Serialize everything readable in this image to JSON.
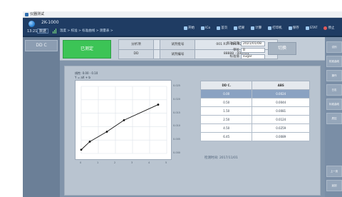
{
  "window": {
    "title": "仪器测试"
  },
  "header": {
    "model": "2K-1000",
    "time": "13:21",
    "mode": "数据",
    "breadcrumb": "温度 > 校准 > 标准曲线 > 测量表 >"
  },
  "toolbar": [
    {
      "label": "开始",
      "icon": "play-icon"
    },
    {
      "label": "ICo",
      "icon": "control-icon"
    },
    {
      "label": "首页",
      "icon": "home-icon"
    },
    {
      "label": "结果",
      "icon": "result-icon"
    },
    {
      "label": "计算",
      "icon": "calc-icon"
    },
    {
      "label": "打印机",
      "icon": "printer-icon"
    },
    {
      "label": "保存",
      "icon": "save-icon"
    },
    {
      "label": "STAT",
      "icon": "stat-icon"
    },
    {
      "label": "停止",
      "icon": "stop-icon"
    }
  ],
  "left_panel": {
    "current": "DD C"
  },
  "info": {
    "status_button": "已测定",
    "rows": [
      {
        "k1": "分析项",
        "v1": "",
        "k2": "试剂批号",
        "v2": "001 R1 · 001 R2 · 001 R3"
      },
      {
        "k1": "DD",
        "v1": "",
        "k2": "试剂编号",
        "v2": "88888 · 000701"
      }
    ],
    "fields": [
      {
        "label": "有效日期",
        "value": "2021/01/08"
      },
      {
        "label": "单位",
        "value": "B"
      },
      {
        "label": "标准值",
        "value": "sugar"
      }
    ],
    "switch_button": "切换"
  },
  "chart_info": [
    "线性: 0.00 · 0.10",
    "Y = aX + b"
  ],
  "chart_data": {
    "type": "line",
    "x": [
      0.0,
      0.5,
      1.5,
      2.5,
      4.5
    ],
    "y": [
      0.0014,
      0.0044,
      0.0081,
      0.0124,
      0.0182
    ],
    "xlim": [
      0,
      5
    ],
    "ylim": [
      0,
      0.025
    ],
    "y_tick_labels": [
      "0.025",
      "0.020",
      "0.015",
      "0.010",
      "0.005",
      "0.000"
    ],
    "x_tick_labels": [
      "0",
      "1",
      "2",
      "3",
      "4",
      "5"
    ],
    "grid": true
  },
  "table": {
    "headers": [
      "DD C.",
      "ABS"
    ],
    "rows": [
      [
        "0.00",
        "0.0024"
      ],
      [
        "0.50",
        "0.0044"
      ],
      [
        "1.50",
        "0.0081"
      ],
      [
        "2.50",
        "0.0124"
      ],
      [
        "4.50",
        "0.0259"
      ],
      [
        "6.45",
        "0.0089"
      ]
    ],
    "selected_row": 0
  },
  "calibration_date": "检测时间: 2017/11/01",
  "right_panel": [
    {
      "label": "试剂"
    },
    {
      "label": "校准曲线"
    },
    {
      "label": "操作"
    },
    {
      "label": "日志"
    },
    {
      "label": "标准曲线"
    },
    {
      "label": "质控"
    }
  ],
  "footer_buttons": [
    {
      "label": "上一页"
    },
    {
      "label": "返回"
    }
  ],
  "colors": {
    "topbar": "#1f3c63",
    "green": "#3cc456",
    "panel": "#8194aa",
    "selected": "#8aa2c2"
  }
}
